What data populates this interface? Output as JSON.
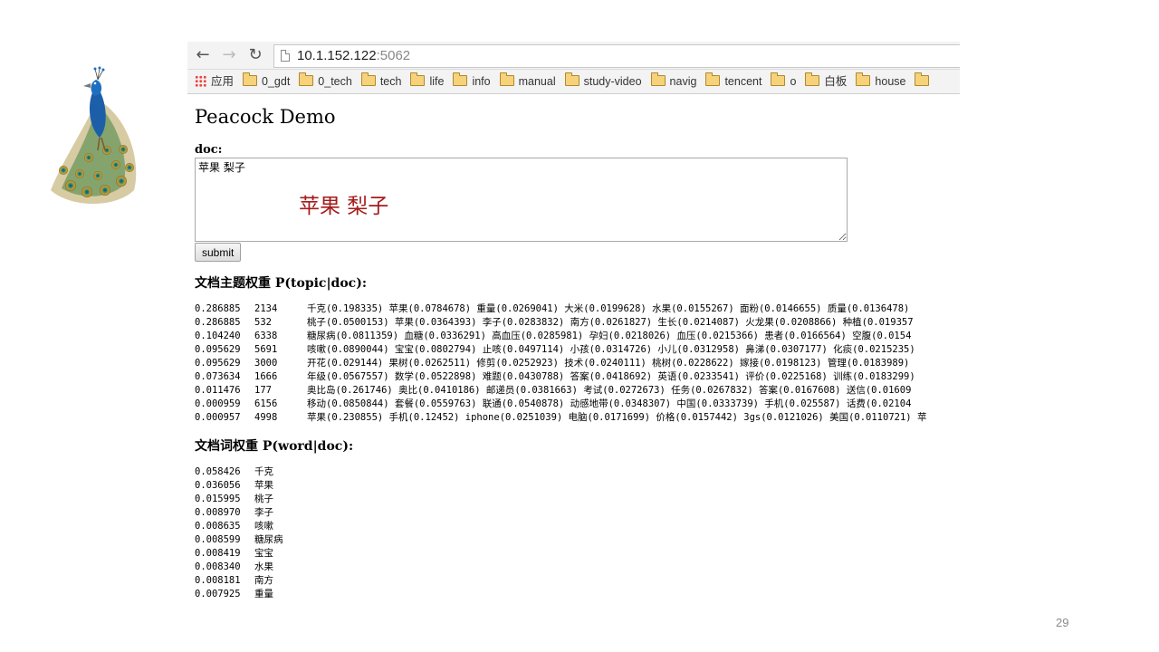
{
  "colors": {
    "overlay": "#a51b1b",
    "url_port": "#888888"
  },
  "browser": {
    "url_host": "10.1.152.122",
    "url_port": ":5062",
    "bookmarks": [
      {
        "label": "应用",
        "icon": "apps-grid-icon"
      },
      {
        "label": "0_gdt",
        "icon": "folder-icon"
      },
      {
        "label": "0_tech",
        "icon": "folder-icon"
      },
      {
        "label": "tech",
        "icon": "folder-icon"
      },
      {
        "label": "life",
        "icon": "folder-icon"
      },
      {
        "label": "info",
        "icon": "folder-icon"
      },
      {
        "label": "manual",
        "icon": "folder-icon"
      },
      {
        "label": "study-video",
        "icon": "folder-icon"
      },
      {
        "label": "navig",
        "icon": "folder-icon"
      },
      {
        "label": "tencent",
        "icon": "folder-icon"
      },
      {
        "label": "o",
        "icon": "folder-icon"
      },
      {
        "label": "白板",
        "icon": "folder-icon"
      },
      {
        "label": "house",
        "icon": "folder-icon"
      },
      {
        "label": "",
        "icon": "folder-icon"
      }
    ]
  },
  "page": {
    "title": "Peacock Demo",
    "doc_label": "doc:",
    "doc_value": "苹果 梨子",
    "submit_label": "submit",
    "topic_heading": "文档主题权重 P(topic|doc):",
    "word_heading": "文档词权重 P(word|doc):",
    "topics": [
      {
        "weight": "0.286885",
        "id": "2134",
        "words": "千克(0.198335) 苹果(0.0784678) 重量(0.0269041) 大米(0.0199628) 水果(0.0155267) 面粉(0.0146655) 质量(0.0136478)"
      },
      {
        "weight": "0.286885",
        "id": "532",
        "words": "桃子(0.0500153) 苹果(0.0364393) 李子(0.0283832) 南方(0.0261827) 生长(0.0214087) 火龙果(0.0208866) 种植(0.019357"
      },
      {
        "weight": "0.104240",
        "id": "6338",
        "words": "糖尿病(0.0811359) 血糖(0.0336291) 高血压(0.0285981) 孕妇(0.0218026) 血压(0.0215366) 患者(0.0166564) 空腹(0.0154"
      },
      {
        "weight": "0.095629",
        "id": "5691",
        "words": "咳嗽(0.0890044) 宝宝(0.0802794) 止咳(0.0497114) 小孩(0.0314726) 小儿(0.0312958) 鼻涕(0.0307177) 化痰(0.0215235)"
      },
      {
        "weight": "0.095629",
        "id": "3000",
        "words": "开花(0.029144) 果树(0.0262511) 修剪(0.0252923) 技术(0.0240111) 桃树(0.0228622) 嫁接(0.0198123) 管理(0.0183989)"
      },
      {
        "weight": "0.073634",
        "id": "1666",
        "words": "年级(0.0567557) 数学(0.0522898) 难题(0.0430788) 答案(0.0418692) 英语(0.0233541) 评价(0.0225168) 训练(0.0183299)"
      },
      {
        "weight": "0.011476",
        "id": "177",
        "words": "奥比岛(0.261746) 奥比(0.0410186) 邮递员(0.0381663) 考试(0.0272673) 任务(0.0267832) 答案(0.0167608) 送信(0.01609"
      },
      {
        "weight": "0.000959",
        "id": "6156",
        "words": "移动(0.0850844) 套餐(0.0559763) 联通(0.0540878) 动感地带(0.0348307) 中国(0.0333739) 手机(0.025587) 话费(0.02104"
      },
      {
        "weight": "0.000957",
        "id": "4998",
        "words": "苹果(0.230855) 手机(0.12452) iphone(0.0251039) 电脑(0.0171699) 价格(0.0157442) 3gs(0.0121026) 美国(0.0110721) 苹"
      }
    ],
    "words": [
      {
        "weight": "0.058426",
        "word": "千克"
      },
      {
        "weight": "0.036056",
        "word": "苹果"
      },
      {
        "weight": "0.015995",
        "word": "桃子"
      },
      {
        "weight": "0.008970",
        "word": "李子"
      },
      {
        "weight": "0.008635",
        "word": "咳嗽"
      },
      {
        "weight": "0.008599",
        "word": "糖尿病"
      },
      {
        "weight": "0.008419",
        "word": "宝宝"
      },
      {
        "weight": "0.008340",
        "word": "水果"
      },
      {
        "weight": "0.008181",
        "word": "南方"
      },
      {
        "weight": "0.007925",
        "word": "重量"
      }
    ]
  },
  "overlay_text": "苹果 梨子",
  "page_number": "29"
}
